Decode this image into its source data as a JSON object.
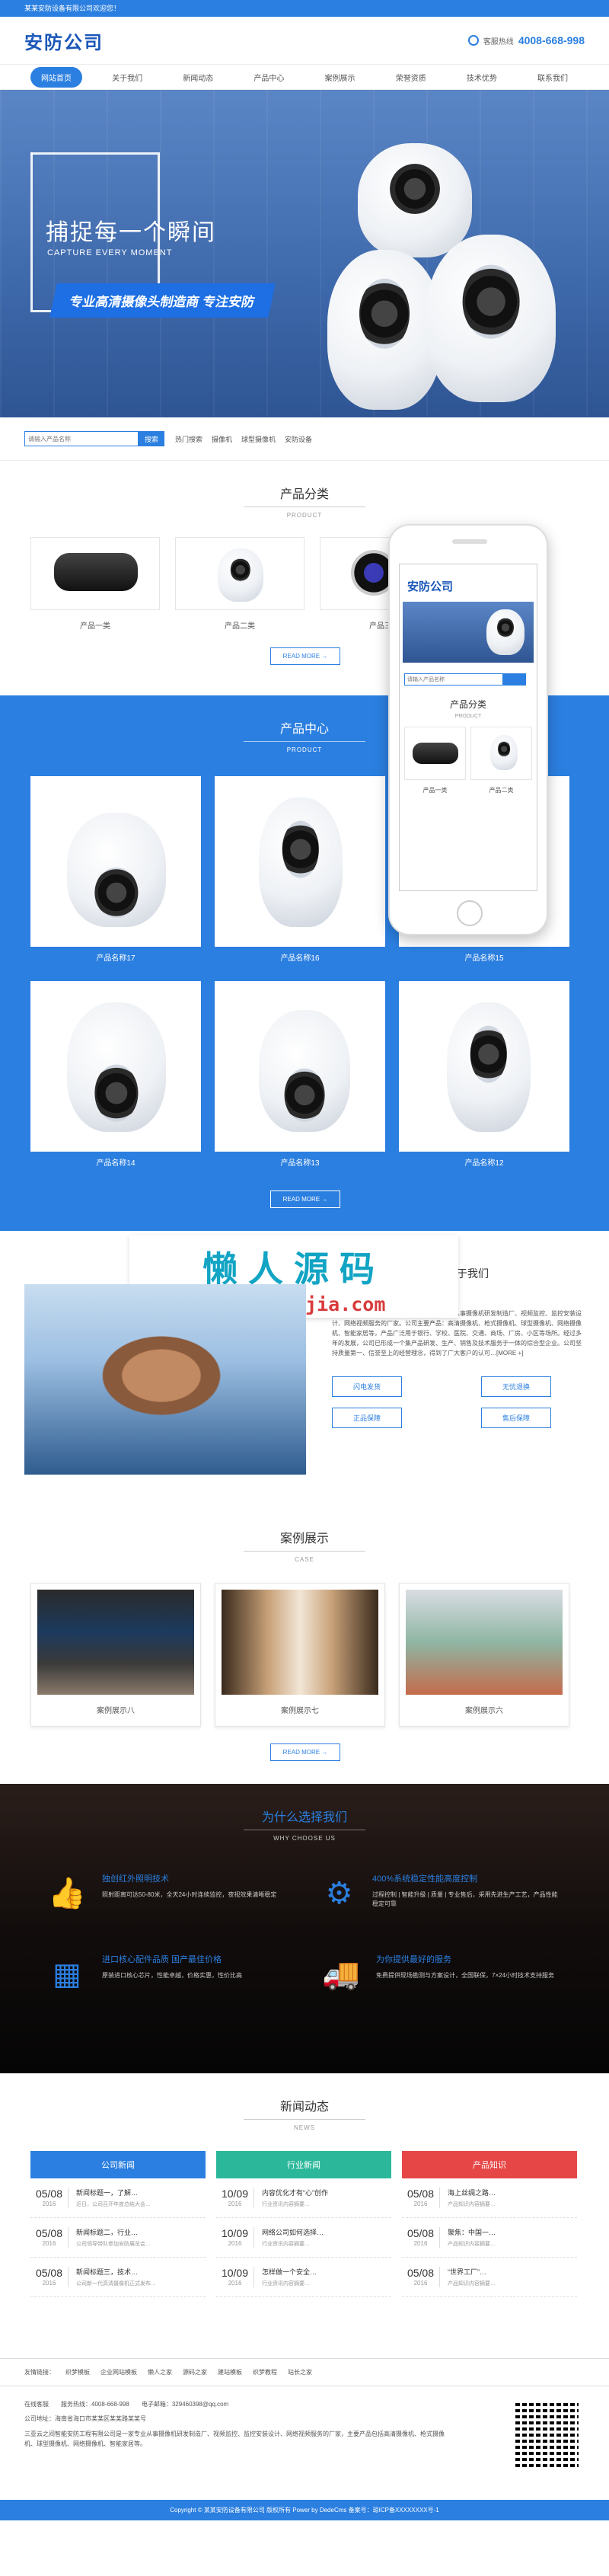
{
  "topbar": {
    "text": "某某安防设备有限公司欢迎您！"
  },
  "header": {
    "logo": "安防公司",
    "hotline_label": "客服热线",
    "hotline_number": "4008-668-998"
  },
  "nav": [
    "网站首页",
    "关于我们",
    "新闻动态",
    "产品中心",
    "案例展示",
    "荣誉资质",
    "技术优势",
    "联系我们"
  ],
  "banner": {
    "headline": "捕捉每一个瞬间",
    "subline": "CAPTURE EVERY MOMENT",
    "ribbon": "专业高清摄像头制造商  专注安防"
  },
  "search": {
    "placeholder": "请输入产品名称",
    "button": "搜索",
    "hot": [
      "热门搜索",
      "摄像机",
      "球型摄像机",
      "安防设备"
    ]
  },
  "categories": {
    "title": "产品分类",
    "subtitle": "PRODUCT",
    "items": [
      "产品一类",
      "产品二类",
      "产品三类"
    ],
    "more": "READ MORE →"
  },
  "mobile": {
    "logo": "安防公司",
    "placeholder": "请输入产品名称",
    "cat_title": "产品分类",
    "cat_sub": "PRODUCT",
    "items": [
      "产品一类",
      "产品二类"
    ]
  },
  "products": {
    "title": "产品中心",
    "subtitle": "PRODUCT",
    "items": [
      "产品名称17",
      "产品名称16",
      "产品名称15",
      "产品名称14",
      "产品名称13",
      "产品名称12"
    ],
    "more": "READ MORE →"
  },
  "watermark": {
    "cn": "懒人源码",
    "en": "lanrenzhijia.com"
  },
  "about": {
    "title": "关于我们",
    "body": "三亚云之间智能安防工程有限公司是一家专业从事摄像机研发制造厂、视频监控、监控安装设计、网络视频服务的厂家。公司主要产品：高清摄像机、枪式摄像机、球型摄像机、网络摄像机、智能家居等，产品广泛用于银行、学校、医院、交通、商场、厂房、小区等场所。经过多年的发展，公司已形成一个集产品研发、生产、销售及技术服务于一体的综合型企业。公司坚持质量第一、信誉至上的经营理念，得到了广大客户的认可…[MORE +]",
    "badges": [
      "闪电发货",
      "无忧退换",
      "正品保障",
      "售后保障"
    ]
  },
  "cases": {
    "title": "案例展示",
    "subtitle": "CASE",
    "items": [
      "案例展示八",
      "案例展示七",
      "案例展示六"
    ],
    "more": "READ MORE →"
  },
  "why": {
    "title": "为什么选择我们",
    "subtitle": "WHY CHOOSE US",
    "items": [
      {
        "title": "独创红外照明技术",
        "text": "照射距离可达50-80米，全天24小时连续监控，夜视效果清晰稳定"
      },
      {
        "title": "400%系统稳定性能高度控制",
        "text": "过程控制 | 智能升级 | 质量 | 专业售后，采用先进生产工艺，产品性能稳定可靠"
      },
      {
        "title": "进口核心配件品质 国产最佳价格",
        "text": "原装进口核心芯片，性能卓越，价格实惠，性价比高"
      },
      {
        "title": "为你提供最好的服务",
        "text": "免费提供现场勘测与方案设计，全国联保，7×24小时技术支持服务"
      }
    ]
  },
  "news": {
    "title": "新闻动态",
    "subtitle": "NEWS",
    "columns": [
      {
        "label": "公司新闻",
        "color": "#2b7fe0",
        "items": [
          {
            "day": "05/08",
            "year": "2016",
            "title": "新闻标题一，了解…",
            "text": "近日，公司召开年度总结大会…"
          },
          {
            "day": "05/08",
            "year": "2016",
            "title": "新闻标题二，行业…",
            "text": "公司领导带队参加安防展览会…"
          },
          {
            "day": "05/08",
            "year": "2016",
            "title": "新闻标题三，技术…",
            "text": "公司新一代高清摄像机正式发布…"
          }
        ]
      },
      {
        "label": "行业新闻",
        "color": "#2bb89a",
        "items": [
          {
            "day": "10/09",
            "year": "2016",
            "title": "内容优化才有“心”创作",
            "text": "行业资讯内容摘要…"
          },
          {
            "day": "10/09",
            "year": "2016",
            "title": "网络公司如何选择…",
            "text": "行业资讯内容摘要…"
          },
          {
            "day": "10/09",
            "year": "2016",
            "title": "怎样做一个安全…",
            "text": "行业资讯内容摘要…"
          }
        ]
      },
      {
        "label": "产品知识",
        "color": "#e64646",
        "items": [
          {
            "day": "05/08",
            "year": "2016",
            "title": "海上丝绸之路…",
            "text": "产品知识内容摘要…"
          },
          {
            "day": "05/08",
            "year": "2016",
            "title": "聚焦：中国一…",
            "text": "产品知识内容摘要…"
          },
          {
            "day": "05/08",
            "year": "2016",
            "title": "“世界工厂”…",
            "text": "产品知识内容摘要…"
          }
        ]
      }
    ]
  },
  "links": [
    "友情链接：",
    "织梦模板",
    "企业网站模板",
    "懒人之家",
    "源码之家",
    "建站模板",
    "织梦教程",
    "站长之家"
  ],
  "footer": {
    "row1": [
      "在线客服",
      "服务热线：4008-668-998",
      "电子邮箱：329460398@qq.com"
    ],
    "row2": "公司地址：海南省海口市某某区某某路某某号",
    "desc": "三亚云之间智能安防工程有限公司是一家专业从事摄像机研发制造厂、视频监控、监控安装设计、网络视频服务的厂家，主要产品包括高清摄像机、枪式摄像机、球型摄像机、网络摄像机、智能家居等。",
    "copyright": "Copyright © 某某安防设备有限公司 版权所有  Power by DedeCms  备案号：琼ICP备XXXXXXXX号-1"
  },
  "colors": {
    "primary": "#2b7fe0",
    "green": "#2bb89a",
    "red": "#e64646"
  }
}
